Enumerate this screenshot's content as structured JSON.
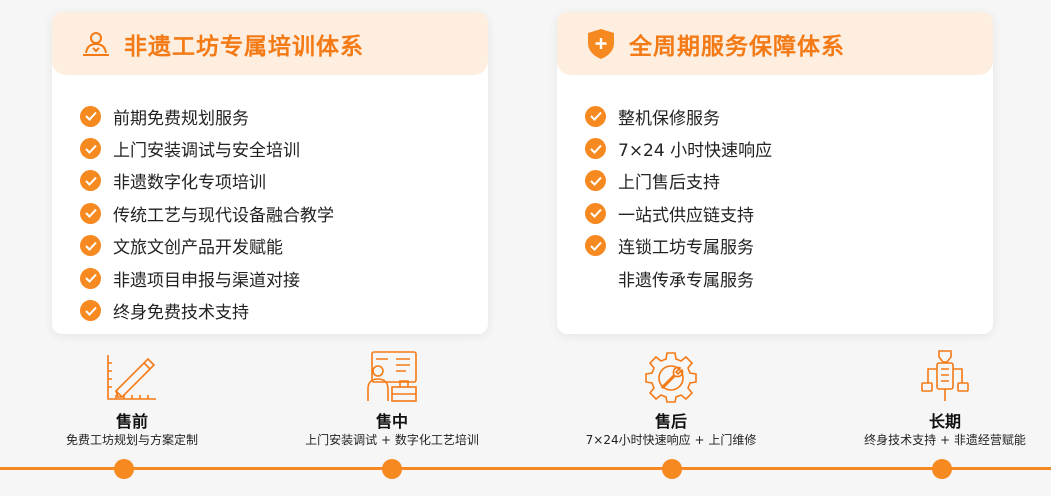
{
  "colors": {
    "accent": "#f6891f",
    "title_orange": "#f47a16",
    "header_bg": "#fdeee0",
    "background": "#f6f6f6"
  },
  "left_card": {
    "icon": "person-board-icon",
    "title": "非遗工坊专属培训体系",
    "items": [
      {
        "label": "前期免费规划服务",
        "checked": true
      },
      {
        "label": "上门安装调试与安全培训",
        "checked": true
      },
      {
        "label": "非遗数字化专项培训",
        "checked": true
      },
      {
        "label": "传统工艺与现代设备融合教学",
        "checked": true
      },
      {
        "label": "文旅文创产品开发赋能",
        "checked": true
      },
      {
        "label": "非遗项目申报与渠道对接",
        "checked": true
      },
      {
        "label": "终身免费技术支持",
        "checked": true
      }
    ]
  },
  "right_card": {
    "icon": "shield-plus-icon",
    "title": "全周期服务保障体系",
    "items": [
      {
        "label": "整机保修服务",
        "checked": true
      },
      {
        "label": "7×24 小时快速响应",
        "checked": true
      },
      {
        "label": "上门售后支持",
        "checked": true
      },
      {
        "label": "一站式供应链支持",
        "checked": true
      },
      {
        "label": "连锁工坊专属服务",
        "checked": true
      },
      {
        "label": "非遗传承专属服务",
        "checked": false
      }
    ]
  },
  "phases": [
    {
      "name": "售前",
      "desc": "免费工坊规划与方案定制",
      "icon": "ruler-pencil-icon"
    },
    {
      "name": "售中",
      "desc": "上门安装调试 + 数字化工艺培训",
      "icon": "worker-desk-icon"
    },
    {
      "name": "售后",
      "desc": "7×24小时快速响应 + 上门维修",
      "icon": "gear-wrench-icon"
    },
    {
      "name": "长期",
      "desc": "终身技术支持 + 非遗经营赋能",
      "icon": "connector-icon"
    }
  ]
}
